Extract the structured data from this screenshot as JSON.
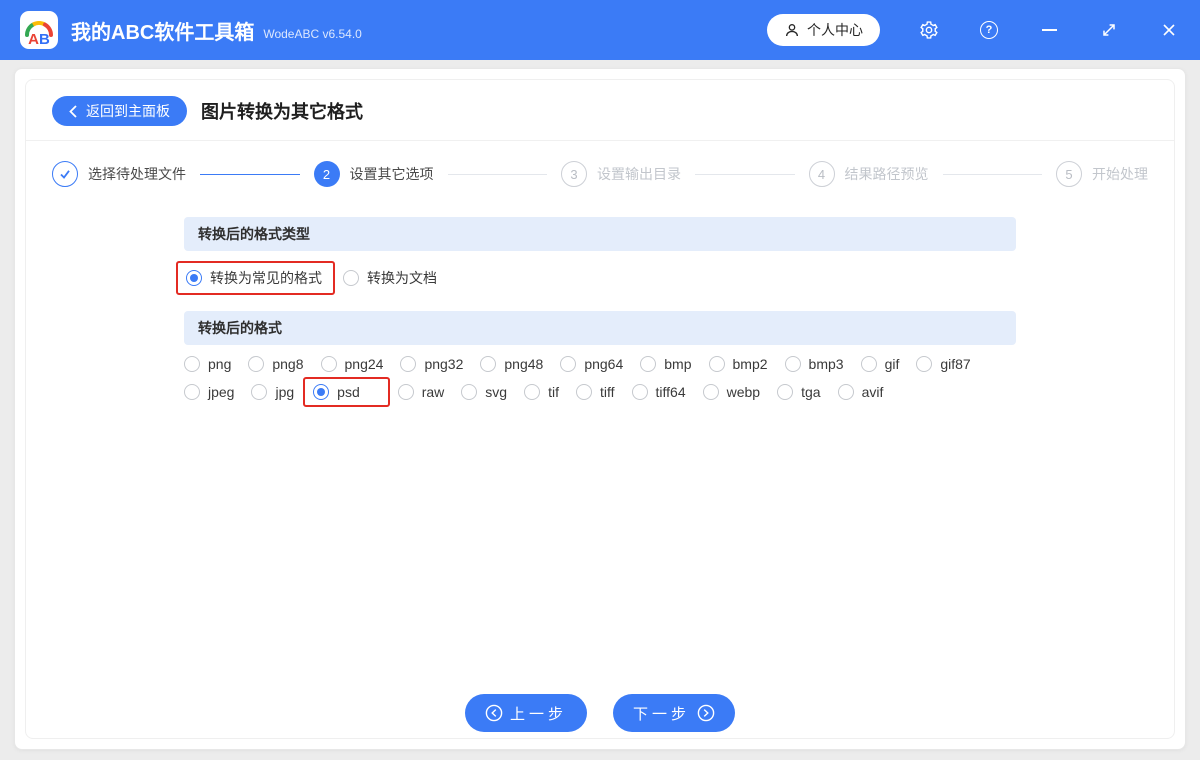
{
  "titlebar": {
    "logo_a": "A",
    "logo_b": "B",
    "app_title": "我的ABC软件工具箱",
    "app_version": "WodeABC v6.54.0",
    "user_center_label": "个人中心",
    "help_glyph": "?"
  },
  "header": {
    "back_label": "返回到主面板",
    "page_title": "图片转换为其它格式"
  },
  "stepper": {
    "steps": [
      {
        "label": "选择待处理文件",
        "state": "done"
      },
      {
        "num": "2",
        "label": "设置其它选项",
        "state": "active"
      },
      {
        "num": "3",
        "label": "设置输出目录",
        "state": "pending"
      },
      {
        "num": "4",
        "label": "结果路径预览",
        "state": "pending"
      },
      {
        "num": "5",
        "label": "开始处理",
        "state": "pending"
      }
    ]
  },
  "type_section": {
    "title": "转换后的格式类型",
    "options": [
      {
        "label": "转换为常见的格式",
        "selected": true,
        "highlighted": true
      },
      {
        "label": "转换为文档",
        "selected": false
      }
    ]
  },
  "format_section": {
    "title": "转换后的格式",
    "row1": [
      {
        "label": "png"
      },
      {
        "label": "png8"
      },
      {
        "label": "png24"
      },
      {
        "label": "png32"
      },
      {
        "label": "png48"
      },
      {
        "label": "png64"
      },
      {
        "label": "bmp"
      },
      {
        "label": "bmp2"
      },
      {
        "label": "bmp3"
      },
      {
        "label": "gif"
      },
      {
        "label": "gif87"
      }
    ],
    "row2": [
      {
        "label": "jpeg"
      },
      {
        "label": "jpg"
      },
      {
        "label": "psd",
        "selected": true,
        "highlighted": true
      },
      {
        "label": "raw"
      },
      {
        "label": "svg"
      },
      {
        "label": "tif"
      },
      {
        "label": "tiff"
      },
      {
        "label": "tiff64"
      },
      {
        "label": "webp"
      },
      {
        "label": "tga"
      },
      {
        "label": "avif"
      }
    ]
  },
  "footer": {
    "prev_label": "上一步",
    "next_label": "下一步"
  },
  "colors": {
    "accent_blue": "#3b7bf6",
    "band_blue": "#e4edfb",
    "highlight_red": "#e32b23"
  }
}
